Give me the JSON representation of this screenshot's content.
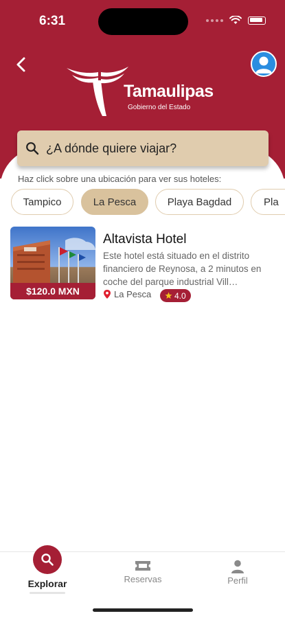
{
  "status_bar": {
    "time": "6:31"
  },
  "brand": {
    "title": "Tamaulipas",
    "subtitle": "Gobierno del Estado",
    "primary_color": "#a51f35",
    "accent_color": "#e0ccae"
  },
  "search": {
    "placeholder": "¿A dónde quiere viajar?"
  },
  "hint": "Haz click sobre una ubicación para ver sus hoteles:",
  "locations": [
    {
      "label": "Tampico",
      "active": false
    },
    {
      "label": "La Pesca",
      "active": true
    },
    {
      "label": "Playa Bagdad",
      "active": false
    },
    {
      "label": "Pla",
      "active": false
    }
  ],
  "hotels": [
    {
      "name": "Altavista Hotel",
      "description": "Este hotel está situado en el distrito financiero de Reynosa, a 2 minutos en coche del parque industrial Vill…",
      "price": "$120.0 MXN",
      "location": "La Pesca",
      "rating": "4.0"
    }
  ],
  "tabs": [
    {
      "label": "Explorar",
      "icon": "search-icon",
      "active": true
    },
    {
      "label": "Reservas",
      "icon": "ticket-icon",
      "active": false
    },
    {
      "label": "Perfil",
      "icon": "person-icon",
      "active": false
    }
  ]
}
